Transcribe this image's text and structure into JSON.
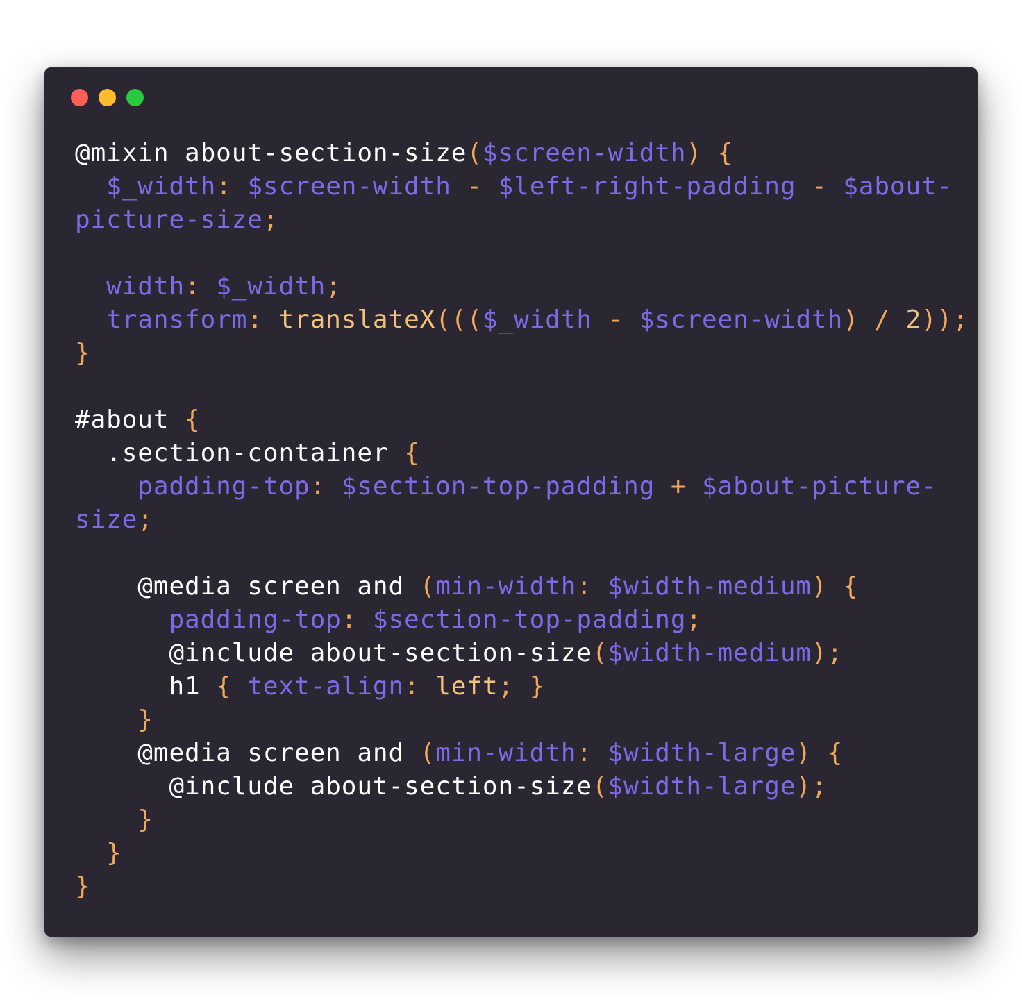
{
  "window": {
    "buttons": [
      {
        "name": "close",
        "color": "#ff5f56"
      },
      {
        "name": "minimize",
        "color": "#ffbd2e"
      },
      {
        "name": "maximize",
        "color": "#27c93f"
      }
    ]
  },
  "theme": {
    "background": "#2a2733",
    "keyword": "#ffffff",
    "variable": "#7e6ae6",
    "punctuation": "#f2a85a",
    "value": "#f2c27a"
  },
  "code": {
    "language": "scss",
    "lines": [
      [
        [
          "kw",
          "@mixin about-section-size"
        ],
        [
          "punc",
          "("
        ],
        [
          "var",
          "$screen-width"
        ],
        [
          "punc",
          ")"
        ],
        [
          "kw",
          " "
        ],
        [
          "punc",
          "{"
        ]
      ],
      [
        [
          "kw",
          "  "
        ],
        [
          "var",
          "$_width"
        ],
        [
          "punc",
          ": "
        ],
        [
          "var",
          "$screen-width"
        ],
        [
          "punc",
          " - "
        ],
        [
          "var",
          "$left-right-padding"
        ],
        [
          "punc",
          " - "
        ],
        [
          "var",
          "$about-"
        ]
      ],
      [
        [
          "var",
          "picture-size"
        ],
        [
          "punc",
          ";"
        ]
      ],
      [],
      [
        [
          "kw",
          "  "
        ],
        [
          "prop",
          "width"
        ],
        [
          "punc",
          ": "
        ],
        [
          "var",
          "$_width"
        ],
        [
          "punc",
          ";"
        ]
      ],
      [
        [
          "kw",
          "  "
        ],
        [
          "prop",
          "transform"
        ],
        [
          "punc",
          ": "
        ],
        [
          "fn",
          "translateX"
        ],
        [
          "punc",
          "((("
        ],
        [
          "var",
          "$_width"
        ],
        [
          "punc",
          " - "
        ],
        [
          "var",
          "$screen-width"
        ],
        [
          "punc",
          ") / "
        ],
        [
          "num",
          "2"
        ],
        [
          "punc",
          "));"
        ]
      ],
      [
        [
          "punc",
          "}"
        ]
      ],
      [],
      [
        [
          "sel",
          "#about "
        ],
        [
          "punc",
          "{"
        ]
      ],
      [
        [
          "sel",
          "  .section-container "
        ],
        [
          "punc",
          "{"
        ]
      ],
      [
        [
          "kw",
          "    "
        ],
        [
          "prop",
          "padding-top"
        ],
        [
          "punc",
          ": "
        ],
        [
          "var",
          "$section-top-padding"
        ],
        [
          "punc",
          " + "
        ],
        [
          "var",
          "$about-picture-"
        ]
      ],
      [
        [
          "var",
          "size"
        ],
        [
          "punc",
          ";"
        ]
      ],
      [],
      [
        [
          "kw",
          "    @media screen and "
        ],
        [
          "punc",
          "("
        ],
        [
          "prop",
          "min-width"
        ],
        [
          "punc",
          ": "
        ],
        [
          "var",
          "$width-medium"
        ],
        [
          "punc",
          ") {"
        ]
      ],
      [
        [
          "kw",
          "      "
        ],
        [
          "prop",
          "padding-top"
        ],
        [
          "punc",
          ": "
        ],
        [
          "var",
          "$section-top-padding"
        ],
        [
          "punc",
          ";"
        ]
      ],
      [
        [
          "kw",
          "      @include about-section-size"
        ],
        [
          "punc",
          "("
        ],
        [
          "var",
          "$width-medium"
        ],
        [
          "punc",
          ");"
        ]
      ],
      [
        [
          "kw",
          "      h1 "
        ],
        [
          "punc",
          "{ "
        ],
        [
          "prop",
          "text-align"
        ],
        [
          "punc",
          ": "
        ],
        [
          "val",
          "left"
        ],
        [
          "punc",
          "; }"
        ]
      ],
      [
        [
          "punc",
          "    }"
        ]
      ],
      [
        [
          "kw",
          "    @media screen and "
        ],
        [
          "punc",
          "("
        ],
        [
          "prop",
          "min-width"
        ],
        [
          "punc",
          ": "
        ],
        [
          "var",
          "$width-large"
        ],
        [
          "punc",
          ") {"
        ]
      ],
      [
        [
          "kw",
          "      @include about-section-size"
        ],
        [
          "punc",
          "("
        ],
        [
          "var",
          "$width-large"
        ],
        [
          "punc",
          ");"
        ]
      ],
      [
        [
          "punc",
          "    }"
        ]
      ],
      [
        [
          "punc",
          "  }"
        ]
      ],
      [
        [
          "punc",
          "}"
        ]
      ]
    ]
  }
}
